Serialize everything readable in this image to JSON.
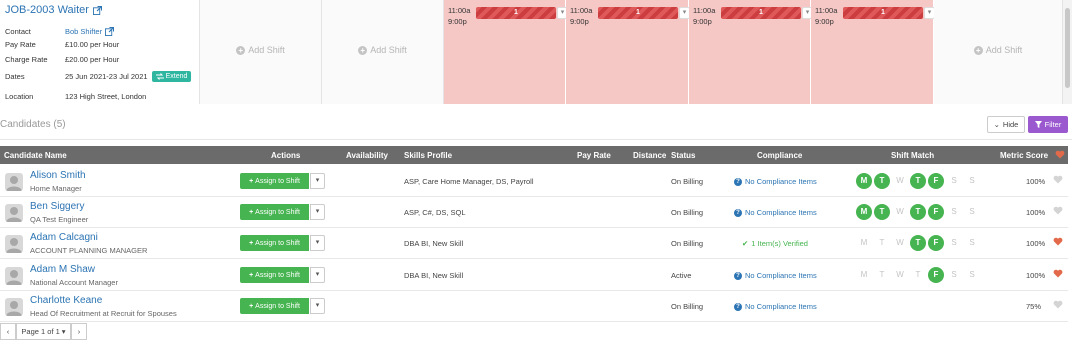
{
  "job": {
    "title": "JOB-2003 Waiter",
    "contact_label": "Contact",
    "contact_value": "Bob Shifter",
    "pay_rate_label": "Pay Rate",
    "pay_rate_value": "£10.00 per Hour",
    "charge_rate_label": "Charge Rate",
    "charge_rate_value": "£20.00 per Hour",
    "dates_label": "Dates",
    "dates_value": "25 Jun 2021-23 Jul 2021",
    "extend_label": "Extend",
    "location_label": "Location",
    "location_value": "123 High Street, London"
  },
  "shifts": {
    "add_label": "Add Shift",
    "filled": [
      {
        "start": "11:00a",
        "end": "9:00p",
        "count": "1"
      },
      {
        "start": "11:00a",
        "end": "9:00p",
        "count": "1"
      },
      {
        "start": "11:00a",
        "end": "9:00p",
        "count": "1"
      },
      {
        "start": "11:00a",
        "end": "9:00p",
        "count": "1"
      }
    ],
    "colors": {
      "filled_bg": "#f5c8c6",
      "bar": "#e0595a"
    }
  },
  "candidates": {
    "title": "Candidates (5)",
    "hide_label": "Hide",
    "filter_label": "Filter",
    "columns": {
      "name": "Candidate Name",
      "actions": "Actions",
      "availability": "Availability",
      "skills": "Skills Profile",
      "pay_rate": "Pay Rate",
      "distance": "Distance",
      "status": "Status",
      "compliance": "Compliance",
      "shift_match": "Shift Match",
      "metric": "Metric Score"
    },
    "assign_label": "Assign to Shift",
    "rows": [
      {
        "name": "Alison Smith",
        "role": "Home Manager",
        "skills": "ASP, Care Home Manager, DS, Payroll",
        "status": "On Billing",
        "compliance": "No Compliance Items",
        "metric": "100%",
        "fav": false
      },
      {
        "name": "Ben Siggery",
        "role": "QA Test Engineer",
        "skills": "ASP, C#, DS, SQL",
        "status": "On Billing",
        "compliance": "No Compliance Items",
        "metric": "100%",
        "fav": false
      },
      {
        "name": "Adam Calcagni",
        "role": "ACCOUNT PLANNING MANAGER",
        "skills": "DBA BI, New Skill",
        "status": "On Billing",
        "compliance": "1 Item(s) Verified",
        "metric": "100%",
        "fav": true
      },
      {
        "name": "Adam M Shaw",
        "role": "National Account Manager",
        "skills": "DBA BI, New Skill",
        "status": "Active",
        "compliance": "No Compliance Items",
        "metric": "100%",
        "fav": true
      },
      {
        "name": "Charlotte Keane",
        "role": "Head Of Recruitment at Recruit for Spouses",
        "skills": "",
        "status": "On Billing",
        "compliance": "No Compliance Items",
        "metric": "75%",
        "fav": false
      }
    ],
    "days": [
      "M",
      "T",
      "W",
      "T",
      "F",
      "S",
      "S"
    ],
    "colors": {
      "header_bg": "#6b6b6b",
      "link": "#2c74b3",
      "green": "#46b450",
      "heart": "#e26a4a"
    }
  },
  "pager": {
    "label": "Page 1 of 1"
  }
}
